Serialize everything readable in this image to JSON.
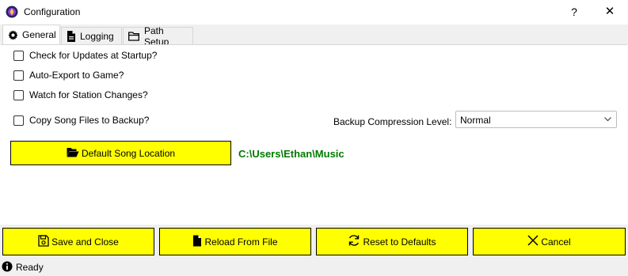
{
  "window": {
    "title": "Configuration",
    "help_label": "?",
    "close_label": "✕",
    "app_icon": "app-logo-icon"
  },
  "tabs": [
    {
      "label": "General",
      "icon": "gear-icon",
      "active": true
    },
    {
      "label": "Logging",
      "icon": "document-icon",
      "active": false
    },
    {
      "label": "Path Setup",
      "icon": "folder-icon",
      "active": false
    }
  ],
  "general": {
    "options": [
      {
        "label": "Check for Updates at Startup?",
        "checked": false
      },
      {
        "label": "Auto-Export to Game?",
        "checked": false
      },
      {
        "label": "Watch for Station Changes?",
        "checked": false
      },
      {
        "label": "Copy Song Files to Backup?",
        "checked": false
      }
    ],
    "compression": {
      "label": "Backup Compression Level:",
      "value": "Normal"
    },
    "default_song": {
      "button_label": "Default Song Location",
      "path": "C:\\Users\\Ethan\\Music"
    }
  },
  "actions": {
    "save": "Save and Close",
    "reload": "Reload From File",
    "reset": "Reset to Defaults",
    "cancel": "Cancel"
  },
  "status": {
    "text": "Ready",
    "icon": "info-icon"
  },
  "colors": {
    "button_bg": "#ffff00",
    "path_text": "#007a00",
    "window_bg": "#f0f0f0"
  }
}
